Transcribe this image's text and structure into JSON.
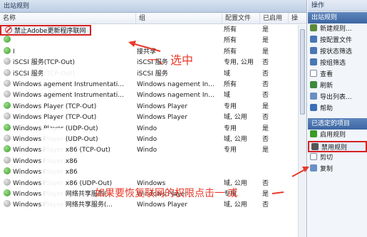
{
  "left_panel": {
    "title": "出站规则",
    "columns": [
      "名称",
      "组",
      "配置文件",
      "已启用",
      "操"
    ],
    "rows": [
      {
        "icon": "blocked",
        "name": "禁止Adobe更新程序联网",
        "group": "",
        "profile": "所有",
        "enabled": "是",
        "action": ""
      },
      {
        "icon": "green",
        "name": "",
        "group": "",
        "profile": "所有",
        "enabled": "是",
        "action": ""
      },
      {
        "icon": "green",
        "name": "I",
        "group": "接共享",
        "profile": "所有",
        "enabled": "是",
        "action": ""
      },
      {
        "icon": "grey",
        "name": "iSCSI 服务(TCP-Out)",
        "group": "iSCSI 服务",
        "profile": "专用, 公用",
        "enabled": "否",
        "action": ""
      },
      {
        "icon": "grey",
        "name": "iSCSI 服务(TCP-Out)",
        "group": "iSCSI 服务",
        "profile": "域",
        "enabled": "否",
        "action": ""
      },
      {
        "icon": "grey",
        "name": "Windows   agement Instrumentati...",
        "group": "Windows   nagement In...",
        "profile": "所有",
        "enabled": "否",
        "action": ""
      },
      {
        "icon": "grey",
        "name": "Windows   agement Instrumentati...",
        "group": "Windows   nagement In...",
        "profile": "域",
        "enabled": "否",
        "action": ""
      },
      {
        "icon": "green",
        "name": "Windows   Player (TCP-Out)",
        "group": "Windows   Player",
        "profile": "专用",
        "enabled": "是",
        "action": ""
      },
      {
        "icon": "grey",
        "name": "Windows   Player (TCP-Out)",
        "group": "Windows   Player",
        "profile": "域, 公用",
        "enabled": "否",
        "action": ""
      },
      {
        "icon": "green",
        "name": "Windows   Player (UDP-Out)",
        "group": "Windo",
        "profile": "专用",
        "enabled": "是",
        "action": ""
      },
      {
        "icon": "grey",
        "name": "Windows   Player (UDP-Out)",
        "group": "Windo",
        "profile": "域, 公用",
        "enabled": "否",
        "action": ""
      },
      {
        "icon": "green",
        "name": "Windows   Player x86 (TCP-Out)",
        "group": "Windo",
        "profile": "专用",
        "enabled": "是",
        "action": ""
      },
      {
        "icon": "grey",
        "name": "Windows   Player x86",
        "group": "",
        "profile": "",
        "enabled": "",
        "action": ""
      },
      {
        "icon": "green",
        "name": "Windows   Player x86",
        "group": "",
        "profile": "",
        "enabled": "",
        "action": ""
      },
      {
        "icon": "grey",
        "name": "Windows   Player x86 (UDP-Out)",
        "group": "Windows",
        "profile": "域, 公用",
        "enabled": "否",
        "action": ""
      },
      {
        "icon": "green",
        "name": "Windows   Player 网络共享服务(...",
        "group": "Windows   Player",
        "profile": "专用",
        "enabled": "是",
        "action": ""
      },
      {
        "icon": "grey",
        "name": "Windows   Player 网络共享服务(...",
        "group": "Windows   Player",
        "profile": "域, 公用",
        "enabled": "否",
        "action": ""
      }
    ]
  },
  "right_panel": {
    "title": "操作",
    "section1": "出站规则",
    "actions1": [
      {
        "label": "新建规则...",
        "icon": "new-rule-icon",
        "color": "#5b8a3c"
      },
      {
        "label": "按配置文件",
        "icon": "filter-icon",
        "color": "#4a76b3"
      },
      {
        "label": "按状态筛选",
        "icon": "filter-icon",
        "color": "#4a76b3"
      },
      {
        "label": "按组筛选",
        "icon": "filter-icon",
        "color": "#4a76b3"
      },
      {
        "label": "查看",
        "icon": "view-icon",
        "color": "#ffffff"
      },
      {
        "label": "刷新",
        "icon": "refresh-icon",
        "color": "#3d8b3d"
      },
      {
        "label": "导出列表...",
        "icon": "export-icon",
        "color": "#6a8fc4"
      },
      {
        "label": "帮助",
        "icon": "help-icon",
        "color": "#3a6fb7"
      }
    ],
    "section2": "已选定的项目",
    "actions2": [
      {
        "label": "启用规则",
        "icon": "enable-icon",
        "color": "#3a9b27"
      },
      {
        "label": "禁用规则",
        "icon": "disable-icon",
        "color": "#555555"
      },
      {
        "label": "剪切",
        "icon": "cut-icon",
        "color": "#ffffff"
      },
      {
        "label": "复制",
        "icon": "copy-icon",
        "color": "#6a8fc4"
      }
    ]
  },
  "annotations": {
    "select_note": "一、选中",
    "restore_note": "如果要恢复联网的权限点击一 或"
  },
  "colors": {
    "accent_red": "#d62222",
    "annot_red": "#e83a2a"
  }
}
